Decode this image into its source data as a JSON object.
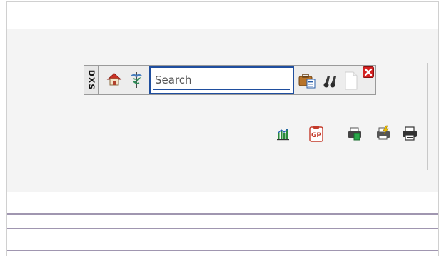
{
  "toolbar": {
    "brand": "DXS",
    "search": {
      "placeholder": "Search",
      "value": ""
    },
    "icons": [
      "home-icon",
      "caduceus-icon",
      "briefcase-list-icon",
      "binoculars-icon",
      "blank-page-icon",
      "close-icon"
    ]
  },
  "action_icons": [
    "bar-chart-icon",
    "gp-clipboard-icon",
    "printer-green-icon",
    "printer-lightning-icon",
    "printer-icon"
  ],
  "colors": {
    "search_border": "#1f4e9e",
    "close_red": "#d42020",
    "panel_bg": "#f4f4f4",
    "divider": "#a096b0"
  }
}
